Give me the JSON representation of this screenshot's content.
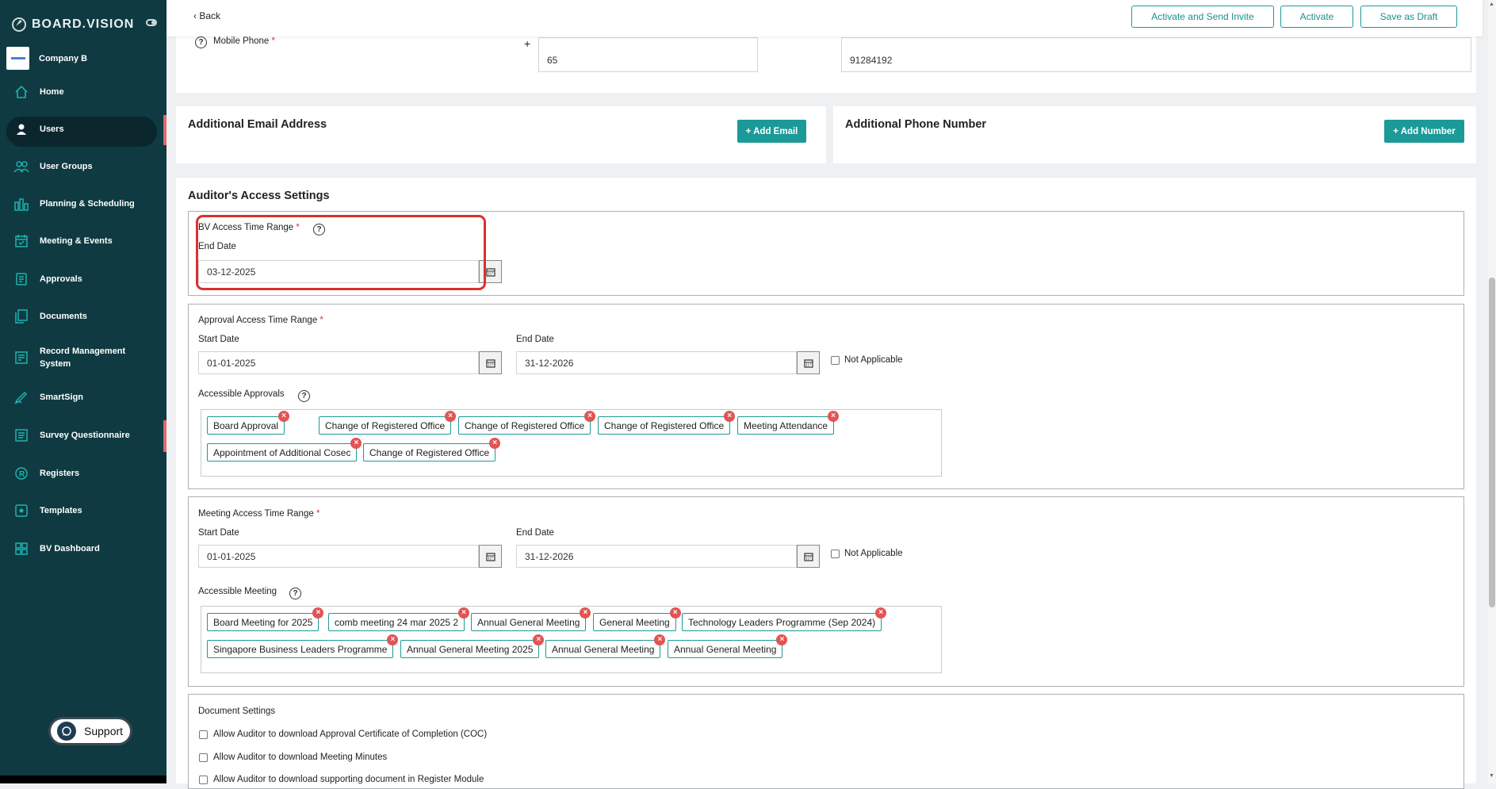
{
  "brand": {
    "name": "BOARD.VISION"
  },
  "company": {
    "name": "Company B"
  },
  "sidebar": {
    "items": [
      {
        "label": "Home",
        "icon": "home-icon"
      },
      {
        "label": "Users",
        "icon": "user-icon"
      },
      {
        "label": "User Groups",
        "icon": "user-groups-icon"
      },
      {
        "label": "Planning & Scheduling",
        "icon": "chart-icon"
      },
      {
        "label": "Meeting & Events",
        "icon": "calendar-icon"
      },
      {
        "label": "Approvals",
        "icon": "approval-icon"
      },
      {
        "label": "Documents",
        "icon": "documents-icon"
      },
      {
        "label": "Record Management System",
        "icon": "record-icon"
      },
      {
        "label": "SmartSign",
        "icon": "pen-icon"
      },
      {
        "label": "Survey Questionnaire",
        "icon": "survey-icon"
      },
      {
        "label": "Registers",
        "icon": "registered-icon"
      },
      {
        "label": "Templates",
        "icon": "template-icon"
      },
      {
        "label": "BV Dashboard",
        "icon": "dashboard-icon"
      }
    ],
    "active": "Users"
  },
  "support": {
    "label": "Support"
  },
  "topbar": {
    "back_label": "Back",
    "activate_send_label": "Activate and Send Invite",
    "activate_label": "Activate",
    "draft_label": "Save as Draft"
  },
  "phone": {
    "label": "Mobile Phone",
    "required": "*",
    "plus": "+",
    "country_code": "65",
    "number": "91284192"
  },
  "email_section": {
    "title": "Additional Email Address",
    "button": "+ Add Email"
  },
  "phone_section": {
    "title": "Additional Phone Number",
    "button": "+ Add Number"
  },
  "access": {
    "title": "Auditor's Access Settings",
    "bv": {
      "label": "BV Access Time Range",
      "required": "*",
      "end_label": "End Date",
      "end_value": "03-12-2025"
    },
    "approval": {
      "label": "Approval Access Time Range",
      "required": "*",
      "start_label": "Start Date",
      "start_value": "01-01-2025",
      "end_label": "End Date",
      "end_value": "31-12-2026",
      "na_label": "Not Applicable",
      "accessible_label": "Accessible Approvals",
      "tags": [
        "Board Approval",
        "Change of Registered Office",
        "Change of Registered Office",
        "Change of Registered Office",
        "Meeting Attendance",
        "Appointment of Additional Cosec",
        "Change of Registered Office"
      ]
    },
    "meeting": {
      "label": "Meeting Access Time Range",
      "required": "*",
      "start_label": "Start Date",
      "start_value": "01-01-2025",
      "end_label": "End Date",
      "end_value": "31-12-2026",
      "na_label": "Not Applicable",
      "accessible_label": "Accessible Meeting",
      "tags": [
        "Board Meeting for 2025",
        "comb meeting 24 mar 2025 2",
        "Annual General Meeting",
        "General Meeting",
        "Technology Leaders Programme (Sep 2024)",
        "Singapore Business Leaders Programme",
        "Annual General Meeting 2025",
        "Annual General Meeting",
        "Annual General Meeting"
      ]
    },
    "documents": {
      "title": "Document Settings",
      "options": [
        "Allow Auditor to download Approval Certificate of Completion (COC)",
        "Allow Auditor to download Meeting Minutes",
        "Allow Auditor to download supporting document in Register Module"
      ]
    }
  },
  "colors": {
    "sidebar": "#0f3a42",
    "accent": "#1c9a97",
    "highlight": "#d9312f",
    "remove": "#e35454"
  }
}
